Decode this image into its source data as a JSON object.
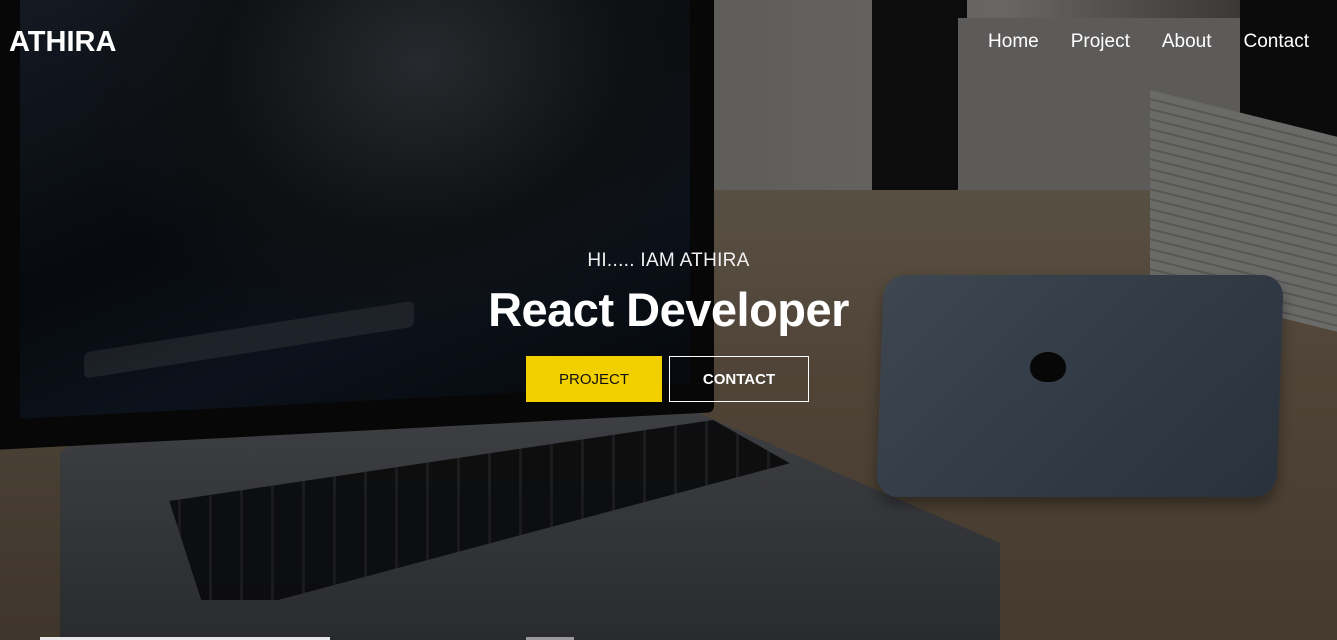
{
  "brand": {
    "name": "ATHIRA"
  },
  "nav": {
    "items": [
      {
        "label": "Home"
      },
      {
        "label": "Project"
      },
      {
        "label": "About"
      },
      {
        "label": "Contact"
      }
    ]
  },
  "hero": {
    "greeting": "HI..... IAM ATHIRA",
    "role": "React Developer",
    "buttons": {
      "project_label": "PROJECT",
      "contact_label": "CONTACT"
    }
  },
  "colors": {
    "accent": "#f2d000",
    "text": "#ffffff",
    "overlay": "rgba(0,0,0,0.56)"
  }
}
